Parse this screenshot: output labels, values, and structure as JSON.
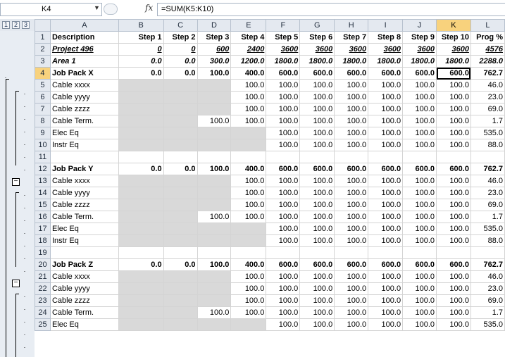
{
  "formula_bar": {
    "name_box": "K4",
    "fx_label": "fx",
    "formula": "=SUM(K5:K10)"
  },
  "outline": {
    "levels": [
      "1",
      "2",
      "3"
    ]
  },
  "columns": [
    "A",
    "B",
    "C",
    "D",
    "E",
    "F",
    "G",
    "H",
    "I",
    "J",
    "K",
    "L"
  ],
  "rows": [
    {
      "n": "1",
      "style": "header",
      "cells": [
        "Description",
        "Step 1",
        "Step 2",
        "Step 3",
        "Step 4",
        "Step 5",
        "Step 6",
        "Step 7",
        "Step 8",
        "Step 9",
        "Step 10",
        "Prog %"
      ]
    },
    {
      "n": "2",
      "style": "project",
      "cells": [
        "Project 496",
        "0",
        "0",
        "600",
        "2400",
        "3600",
        "3600",
        "3600",
        "3600",
        "3600",
        "3600",
        "4576"
      ]
    },
    {
      "n": "3",
      "style": "area",
      "cells": [
        "Area 1",
        "0.0",
        "0.0",
        "300.0",
        "1200.0",
        "1800.0",
        "1800.0",
        "1800.0",
        "1800.0",
        "1800.0",
        "1800.0",
        "2288.0"
      ]
    },
    {
      "n": "4",
      "style": "jobpack",
      "cells": [
        "Job Pack X",
        "0.0",
        "0.0",
        "100.0",
        "400.0",
        "600.0",
        "600.0",
        "600.0",
        "600.0",
        "600.0",
        "600.0",
        "762.7"
      ]
    },
    {
      "n": "5",
      "style": "item",
      "gray": [
        1,
        2,
        3
      ],
      "cells": [
        "Cable xxxx",
        "",
        "",
        "",
        "100.0",
        "100.0",
        "100.0",
        "100.0",
        "100.0",
        "100.0",
        "100.0",
        "46.0"
      ]
    },
    {
      "n": "6",
      "style": "item",
      "gray": [
        1,
        2,
        3
      ],
      "cells": [
        "Cable yyyy",
        "",
        "",
        "",
        "100.0",
        "100.0",
        "100.0",
        "100.0",
        "100.0",
        "100.0",
        "100.0",
        "23.0"
      ]
    },
    {
      "n": "7",
      "style": "item",
      "gray": [
        1,
        2,
        3
      ],
      "cells": [
        "Cable zzzz",
        "",
        "",
        "",
        "100.0",
        "100.0",
        "100.0",
        "100.0",
        "100.0",
        "100.0",
        "100.0",
        "69.0"
      ]
    },
    {
      "n": "8",
      "style": "item",
      "gray": [
        1,
        2
      ],
      "cells": [
        "Cable Term.",
        "",
        "",
        "100.0",
        "100.0",
        "100.0",
        "100.0",
        "100.0",
        "100.0",
        "100.0",
        "100.0",
        "1.7"
      ]
    },
    {
      "n": "9",
      "style": "item",
      "gray": [
        1,
        2,
        3,
        4
      ],
      "cells": [
        "Elec Eq",
        "",
        "",
        "",
        "",
        "100.0",
        "100.0",
        "100.0",
        "100.0",
        "100.0",
        "100.0",
        "535.0"
      ]
    },
    {
      "n": "10",
      "style": "item",
      "gray": [
        1,
        2,
        3,
        4
      ],
      "cells": [
        "Instr Eq",
        "",
        "",
        "",
        "",
        "100.0",
        "100.0",
        "100.0",
        "100.0",
        "100.0",
        "100.0",
        "88.0"
      ]
    },
    {
      "n": "11",
      "style": "blank",
      "cells": [
        "",
        "",
        "",
        "",
        "",
        "",
        "",
        "",
        "",
        "",
        "",
        ""
      ]
    },
    {
      "n": "12",
      "style": "jobpack",
      "cells": [
        "Job Pack Y",
        "0.0",
        "0.0",
        "100.0",
        "400.0",
        "600.0",
        "600.0",
        "600.0",
        "600.0",
        "600.0",
        "600.0",
        "762.7"
      ]
    },
    {
      "n": "13",
      "style": "item",
      "gray": [
        1,
        2,
        3
      ],
      "cells": [
        "Cable xxxx",
        "",
        "",
        "",
        "100.0",
        "100.0",
        "100.0",
        "100.0",
        "100.0",
        "100.0",
        "100.0",
        "46.0"
      ]
    },
    {
      "n": "14",
      "style": "item",
      "gray": [
        1,
        2,
        3
      ],
      "cells": [
        "Cable yyyy",
        "",
        "",
        "",
        "100.0",
        "100.0",
        "100.0",
        "100.0",
        "100.0",
        "100.0",
        "100.0",
        "23.0"
      ]
    },
    {
      "n": "15",
      "style": "item",
      "gray": [
        1,
        2,
        3
      ],
      "cells": [
        "Cable zzzz",
        "",
        "",
        "",
        "100.0",
        "100.0",
        "100.0",
        "100.0",
        "100.0",
        "100.0",
        "100.0",
        "69.0"
      ]
    },
    {
      "n": "16",
      "style": "item",
      "gray": [
        1,
        2
      ],
      "cells": [
        "Cable Term.",
        "",
        "",
        "100.0",
        "100.0",
        "100.0",
        "100.0",
        "100.0",
        "100.0",
        "100.0",
        "100.0",
        "1.7"
      ]
    },
    {
      "n": "17",
      "style": "item",
      "gray": [
        1,
        2,
        3,
        4
      ],
      "cells": [
        "Elec Eq",
        "",
        "",
        "",
        "",
        "100.0",
        "100.0",
        "100.0",
        "100.0",
        "100.0",
        "100.0",
        "535.0"
      ]
    },
    {
      "n": "18",
      "style": "item",
      "gray": [
        1,
        2,
        3,
        4
      ],
      "cells": [
        "Instr Eq",
        "",
        "",
        "",
        "",
        "100.0",
        "100.0",
        "100.0",
        "100.0",
        "100.0",
        "100.0",
        "88.0"
      ]
    },
    {
      "n": "19",
      "style": "blank",
      "cells": [
        "",
        "",
        "",
        "",
        "",
        "",
        "",
        "",
        "",
        "",
        "",
        ""
      ]
    },
    {
      "n": "20",
      "style": "jobpack",
      "cells": [
        "Job Pack Z",
        "0.0",
        "0.0",
        "100.0",
        "400.0",
        "600.0",
        "600.0",
        "600.0",
        "600.0",
        "600.0",
        "600.0",
        "762.7"
      ]
    },
    {
      "n": "21",
      "style": "item",
      "gray": [
        1,
        2,
        3
      ],
      "cells": [
        "Cable xxxx",
        "",
        "",
        "",
        "100.0",
        "100.0",
        "100.0",
        "100.0",
        "100.0",
        "100.0",
        "100.0",
        "46.0"
      ]
    },
    {
      "n": "22",
      "style": "item",
      "gray": [
        1,
        2,
        3
      ],
      "cells": [
        "Cable yyyy",
        "",
        "",
        "",
        "100.0",
        "100.0",
        "100.0",
        "100.0",
        "100.0",
        "100.0",
        "100.0",
        "23.0"
      ]
    },
    {
      "n": "23",
      "style": "item",
      "gray": [
        1,
        2,
        3
      ],
      "cells": [
        "Cable zzzz",
        "",
        "",
        "",
        "100.0",
        "100.0",
        "100.0",
        "100.0",
        "100.0",
        "100.0",
        "100.0",
        "69.0"
      ]
    },
    {
      "n": "24",
      "style": "item",
      "gray": [
        1,
        2
      ],
      "cells": [
        "Cable Term.",
        "",
        "",
        "100.0",
        "100.0",
        "100.0",
        "100.0",
        "100.0",
        "100.0",
        "100.0",
        "100.0",
        "1.7"
      ]
    },
    {
      "n": "25",
      "style": "item",
      "gray": [
        1,
        2,
        3,
        4
      ],
      "cells": [
        "Elec Eq",
        "",
        "",
        "",
        "",
        "100.0",
        "100.0",
        "100.0",
        "100.0",
        "100.0",
        "100.0",
        "535.0"
      ]
    }
  ],
  "selection": {
    "row": "4",
    "col": "K"
  },
  "colors": {
    "selected_header": "#f8d27d",
    "gray_fill": "#d9d9d9",
    "header_bg": "#e4e9f0"
  }
}
